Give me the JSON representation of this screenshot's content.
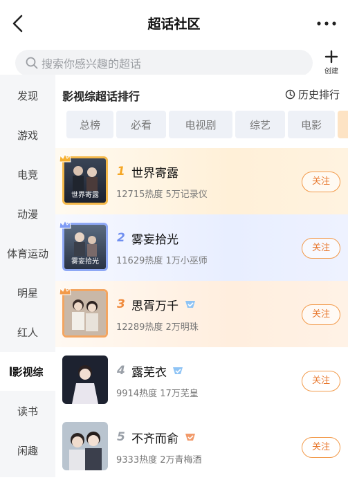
{
  "header": {
    "title": "超话社区"
  },
  "search": {
    "placeholder": "搜索你感兴趣的超话",
    "create_label": "创建"
  },
  "sidebar": {
    "items": [
      {
        "label": "发现"
      },
      {
        "label": "游戏"
      },
      {
        "label": "电竞"
      },
      {
        "label": "动漫"
      },
      {
        "label": "体育运动"
      },
      {
        "label": "明星"
      },
      {
        "label": "红人"
      },
      {
        "label": "影视综",
        "active": true
      },
      {
        "label": "读书"
      },
      {
        "label": "闲趣"
      }
    ]
  },
  "section": {
    "title": "影视综超话排行",
    "history_label": "历史排行"
  },
  "tabs": [
    {
      "label": "总榜"
    },
    {
      "label": "必看"
    },
    {
      "label": "电视剧"
    },
    {
      "label": "综艺"
    },
    {
      "label": "电影"
    }
  ],
  "list": [
    {
      "rank": "1",
      "name": "世界寄露",
      "heat": "12715",
      "heat_label": "热度",
      "members": "5万记录仪",
      "follow": "关注",
      "rank_color": "#f5a623",
      "thumb_text": "世界寄露"
    },
    {
      "rank": "2",
      "name": "雾妄拾光",
      "heat": "11629",
      "heat_label": "热度",
      "members": "1万小巫师",
      "follow": "关注",
      "rank_color": "#6f8ff0",
      "thumb_text": "雾妄拾光"
    },
    {
      "rank": "3",
      "name": "思胥万千",
      "heat": "12289",
      "heat_label": "热度",
      "members": "2万明珠",
      "follow": "关注",
      "rank_color": "#f08a3c"
    },
    {
      "rank": "4",
      "name": "露芜衣",
      "heat": "9914",
      "heat_label": "热度",
      "members": "17万芜皇",
      "follow": "关注",
      "rank_color": "#9aa0a8"
    },
    {
      "rank": "5",
      "name": "不齐而俞",
      "heat": "9333",
      "heat_label": "热度",
      "members": "2万青梅酒",
      "follow": "关注",
      "rank_color": "#9aa0a8"
    }
  ],
  "colors": {
    "accent": "#e8782e",
    "sidebar_bg": "#f5f6f8",
    "tab_bg": "#eef1f7"
  }
}
